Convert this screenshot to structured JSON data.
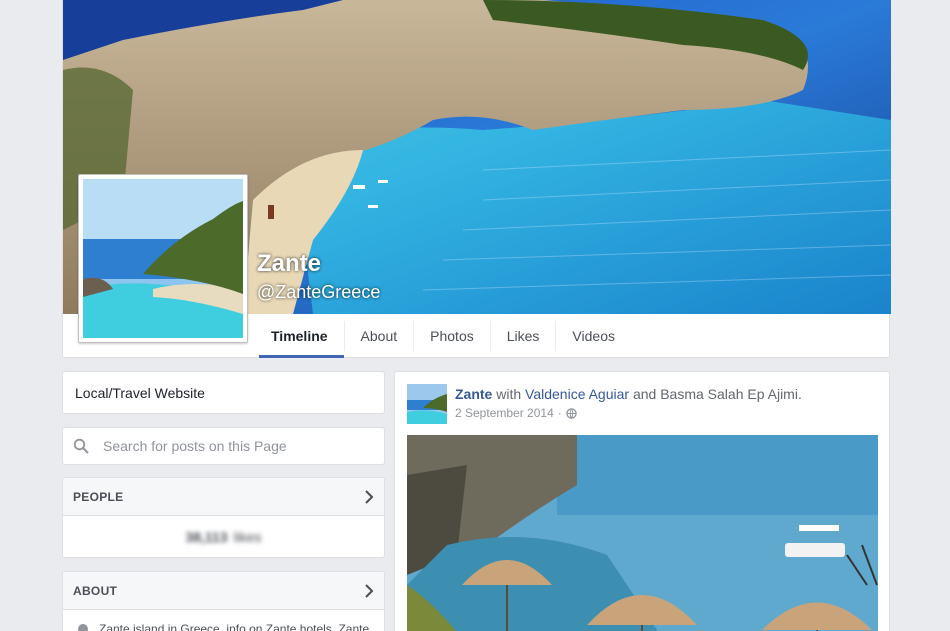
{
  "page": {
    "name": "Zante",
    "handle": "@ZanteGreece"
  },
  "tabs": [
    {
      "label": "Timeline",
      "active": true
    },
    {
      "label": "About"
    },
    {
      "label": "Photos"
    },
    {
      "label": "Likes"
    },
    {
      "label": "Videos"
    }
  ],
  "sidebar": {
    "category": "Local/Travel Website",
    "search_placeholder": "Search for posts on this Page",
    "people": {
      "heading": "PEOPLE",
      "likes_count": "38,113",
      "likes_label": "likes"
    },
    "about": {
      "heading": "ABOUT",
      "text": "Zante island in Greece, info on Zante hotels, Zante"
    }
  },
  "post": {
    "author": "Zante",
    "with_word": "with",
    "tagged": "Valdenice Aguiar",
    "and_word": "and",
    "tagged2": "Basma Salah Ep Ajimi.",
    "date": "2 September 2014",
    "separator": "·"
  },
  "icons": {
    "search": "search-icon",
    "chevron": "chevron-right-icon",
    "globe": "globe-icon",
    "info": "info-icon"
  },
  "colors": {
    "link": "#365899",
    "accent": "#4267b2",
    "background": "#e9ebee"
  }
}
